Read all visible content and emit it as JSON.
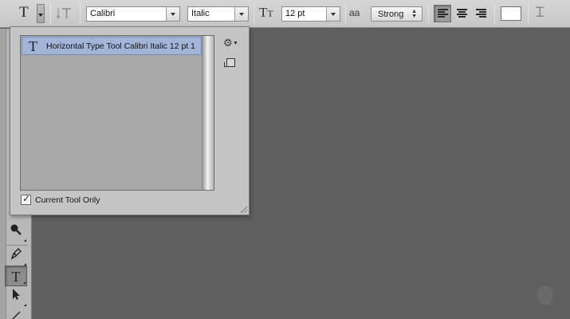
{
  "options_bar": {
    "tool_glyph": "T",
    "font_family": "Calibri",
    "font_style": "Italic",
    "size_glyph": "T",
    "font_size": "12 pt",
    "aa_glyph": "aa",
    "antialias": "Strong",
    "text_color": "#ffffff",
    "warp_glyph": "Ꮖ"
  },
  "preset_popup": {
    "items": [
      {
        "icon": "T",
        "label": "Horizontal Type Tool Calibri Italic 12 pt 1",
        "selected": true
      }
    ],
    "current_tool_only_label": "Current Tool Only",
    "current_tool_only_checked": true
  },
  "tools": {
    "active_glyph": "T"
  },
  "colors": {
    "canvas_bg": "#5f5f5f",
    "selection": "#a2b4d8"
  }
}
